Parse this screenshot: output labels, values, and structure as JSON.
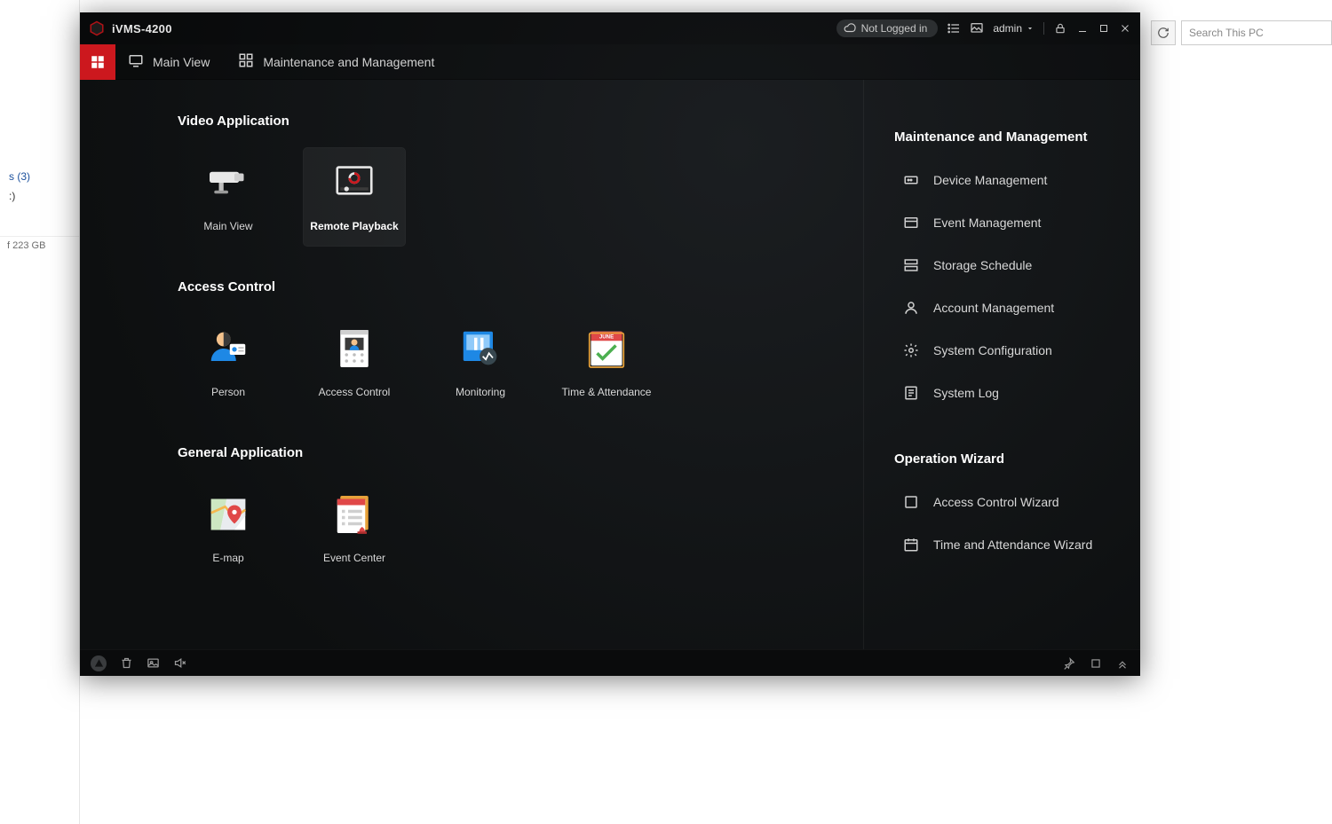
{
  "host": {
    "tree_item": "s (3)",
    "drive_label": ":)",
    "disk_usage": "f 223 GB",
    "search_placeholder": "Search This PC"
  },
  "app": {
    "title": "iVMS-4200",
    "login_status": "Not Logged in",
    "user": "admin"
  },
  "tabs": {
    "main_view": "Main View",
    "maint_mgmt": "Maintenance and Management"
  },
  "sections": {
    "video": {
      "title": "Video Application",
      "items": [
        "Main View",
        "Remote Playback"
      ]
    },
    "access": {
      "title": "Access Control",
      "items": [
        "Person",
        "Access Control",
        "Monitoring",
        "Time & Attendance"
      ]
    },
    "general": {
      "title": "General Application",
      "items": [
        "E-map",
        "Event Center"
      ]
    }
  },
  "sidebar": {
    "maint": {
      "title": "Maintenance and Management",
      "items": [
        "Device Management",
        "Event Management",
        "Storage Schedule",
        "Account Management",
        "System Configuration",
        "System Log"
      ]
    },
    "wizard": {
      "title": "Operation Wizard",
      "items": [
        "Access Control Wizard",
        "Time and Attendance Wizard"
      ]
    }
  },
  "calendar_month": "JUNE"
}
